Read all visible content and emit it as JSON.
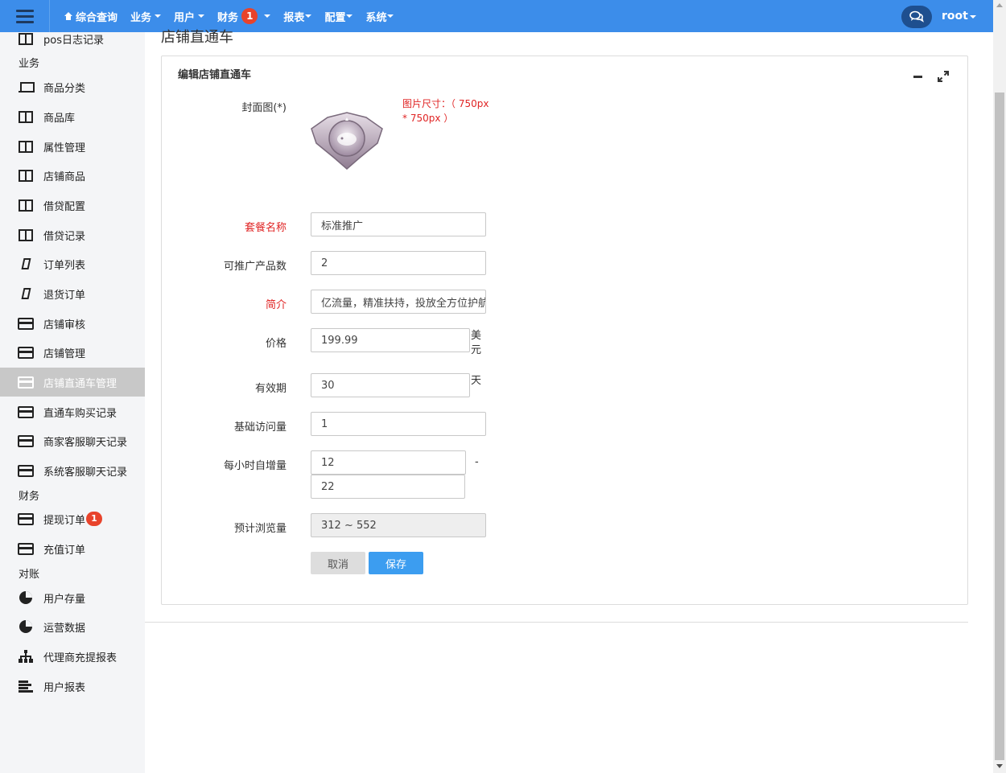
{
  "topbar": {
    "nav": [
      {
        "label": "综合查询",
        "icon": "home-icon"
      },
      {
        "label": "业务"
      },
      {
        "label": "用户"
      },
      {
        "label": "财务",
        "badge": "1"
      },
      {
        "label": "报表"
      },
      {
        "label": "配置"
      },
      {
        "label": "系统"
      }
    ],
    "user": "root",
    "colors": {
      "bar": "#3c8dea",
      "badge": "#e8432b"
    }
  },
  "sidebar": {
    "top_item": "pos日志记录",
    "group_business": "业务",
    "items_business": [
      "商品分类",
      "商品库",
      "属性管理",
      "店铺商品",
      "借贷配置",
      "借贷记录",
      "订单列表",
      "退货订单",
      "店铺审核",
      "店铺管理",
      "店铺直通车管理",
      "直通车购买记录",
      "商家客服聊天记录",
      "系统客服聊天记录"
    ],
    "group_finance": "财务",
    "items_finance": [
      "提现订单",
      "充值订单"
    ],
    "finance_badge": "1",
    "group_recon": "对账",
    "items_recon": [
      "用户存量",
      "运营数据",
      "代理商充提报表",
      "用户报表"
    ],
    "active": "店铺直通车管理"
  },
  "page": {
    "title": "店铺直通车",
    "panel_title": "编辑店铺直通车"
  },
  "form": {
    "cover_label": "封面图(*)",
    "cover_hint": "图片尺寸：（ 750px * 750px ）",
    "name_label": "套餐名称",
    "name_value": "标准推广",
    "count_label": "可推广产品数",
    "count_value": "2",
    "intro_label": "简介",
    "intro_value": "亿流量，精准扶持，投放全方位护航",
    "price_label": "价格",
    "price_value": "199.99",
    "price_unit": "美元",
    "valid_label": "有效期",
    "valid_value": "30",
    "valid_unit": "天",
    "base_label": "基础访问量",
    "base_value": "1",
    "hourly_label": "每小时自增量",
    "hourly_min": "12",
    "hourly_sep": "-",
    "hourly_max": "22",
    "estimate_label": "预计浏览量",
    "estimate_value": "312 ~ 552",
    "cancel_label": "取消",
    "save_label": "保存"
  }
}
